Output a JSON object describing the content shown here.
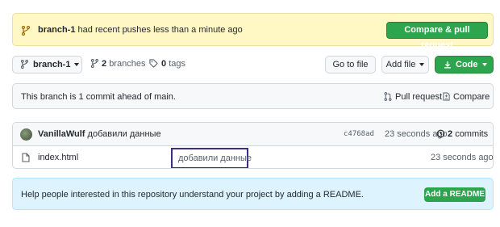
{
  "banner": {
    "branch": "branch-1",
    "message": "had recent pushes less than a minute ago",
    "compare_button": "Compare & pull request"
  },
  "toolbar": {
    "branch_select": "branch-1",
    "branches_count": "2",
    "branches_label": "branches",
    "tags_count": "0",
    "tags_label": "tags",
    "goto_file": "Go to file",
    "add_file": "Add file",
    "code": "Code"
  },
  "ahead": {
    "text": "This branch is 1 commit ahead of main.",
    "pull_request": "Pull request",
    "compare": "Compare"
  },
  "commit": {
    "author": "VanillaWulf",
    "message": "добавили данные",
    "sha": "c4768ad",
    "time": "23 seconds ago",
    "commits_count": "2",
    "commits_label": "commits"
  },
  "files": [
    {
      "name": "index.html",
      "message": "добавили данные",
      "time": "23 seconds ago"
    }
  ],
  "readme": {
    "text": "Help people interested in this repository understand your project by adding a README.",
    "button": "Add a README"
  },
  "colors": {
    "banner_bg": "#fff8c5",
    "primary_green": "#2da44e",
    "readme_bg": "#ddf4ff",
    "highlight_border": "#3a2d8c"
  }
}
